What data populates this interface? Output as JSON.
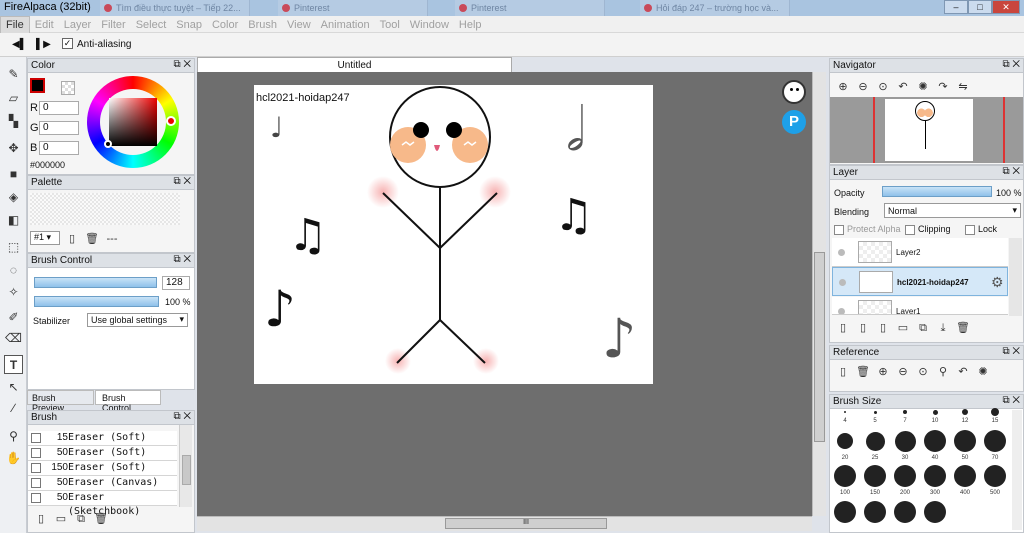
{
  "app": {
    "title": "FireAlpaca (32bit)"
  },
  "browser_tabs": [
    "Tìm điều thực tuyệt ‒ Tiếp 22...",
    "Pinterest",
    "Pinterest",
    "Hỏi đáp 247 ‒ trường học và..."
  ],
  "window_controls": {
    "min": "–",
    "max": "□",
    "close": "✕"
  },
  "menu": [
    "File",
    "Edit",
    "Layer",
    "Filter",
    "Select",
    "Snap",
    "Color",
    "Brush",
    "View",
    "Animation",
    "Tool",
    "Window",
    "Help"
  ],
  "toolbar": {
    "antialias_label": "Anti-aliasing",
    "antialias_checked": true
  },
  "color_panel": {
    "title": "Color",
    "r_label": "R",
    "g_label": "G",
    "b_label": "B",
    "r": "0",
    "g": "0",
    "b": "0",
    "hex": "#000000"
  },
  "palette_panel": {
    "title": "Palette",
    "selected": "#1",
    "more": "---"
  },
  "brush_control": {
    "title": "Brush Control",
    "size": "128",
    "opacity": "100 %",
    "stabilizer_label": "Stabilizer",
    "stabilizer_value": "Use global settings"
  },
  "bottom_tabs": [
    "Brush Preview",
    "Brush Control"
  ],
  "brush_panel": {
    "title": "Brush",
    "items": [
      {
        "size": "15",
        "name": "Eraser (Soft)"
      },
      {
        "size": "50",
        "name": "Eraser (Soft)"
      },
      {
        "size": "150",
        "name": "Eraser (Soft)"
      },
      {
        "size": "50",
        "name": "Eraser (Canvas)"
      },
      {
        "size": "50",
        "name": "Eraser (Sketchbook)"
      }
    ]
  },
  "document": {
    "tab": "Untitled",
    "watermark": "hcl2021-hoidap247"
  },
  "navigator": {
    "title": "Navigator"
  },
  "layer_panel": {
    "title": "Layer",
    "opacity_label": "Opacity",
    "opacity": "100 %",
    "blending_label": "Blending",
    "blending": "Normal",
    "protect_alpha": "Protect Alpha",
    "clipping": "Clipping",
    "lock": "Lock",
    "layers": [
      "Layer2",
      "hcl2021-hoidap247",
      "Layer1"
    ]
  },
  "reference_panel": {
    "title": "Reference"
  },
  "brush_size_panel": {
    "title": "Brush Size",
    "row1": [
      "4",
      "5",
      "7",
      "10",
      "12",
      "15"
    ],
    "row2": [
      "20",
      "25",
      "30",
      "40",
      "50",
      "70"
    ],
    "row3": [
      "100",
      "150",
      "200",
      "300",
      "400",
      "500"
    ]
  },
  "colors": {
    "accent": "#8fc1ea",
    "canvas_bg": "#6e6e6e",
    "blush": "#f7b98a"
  }
}
